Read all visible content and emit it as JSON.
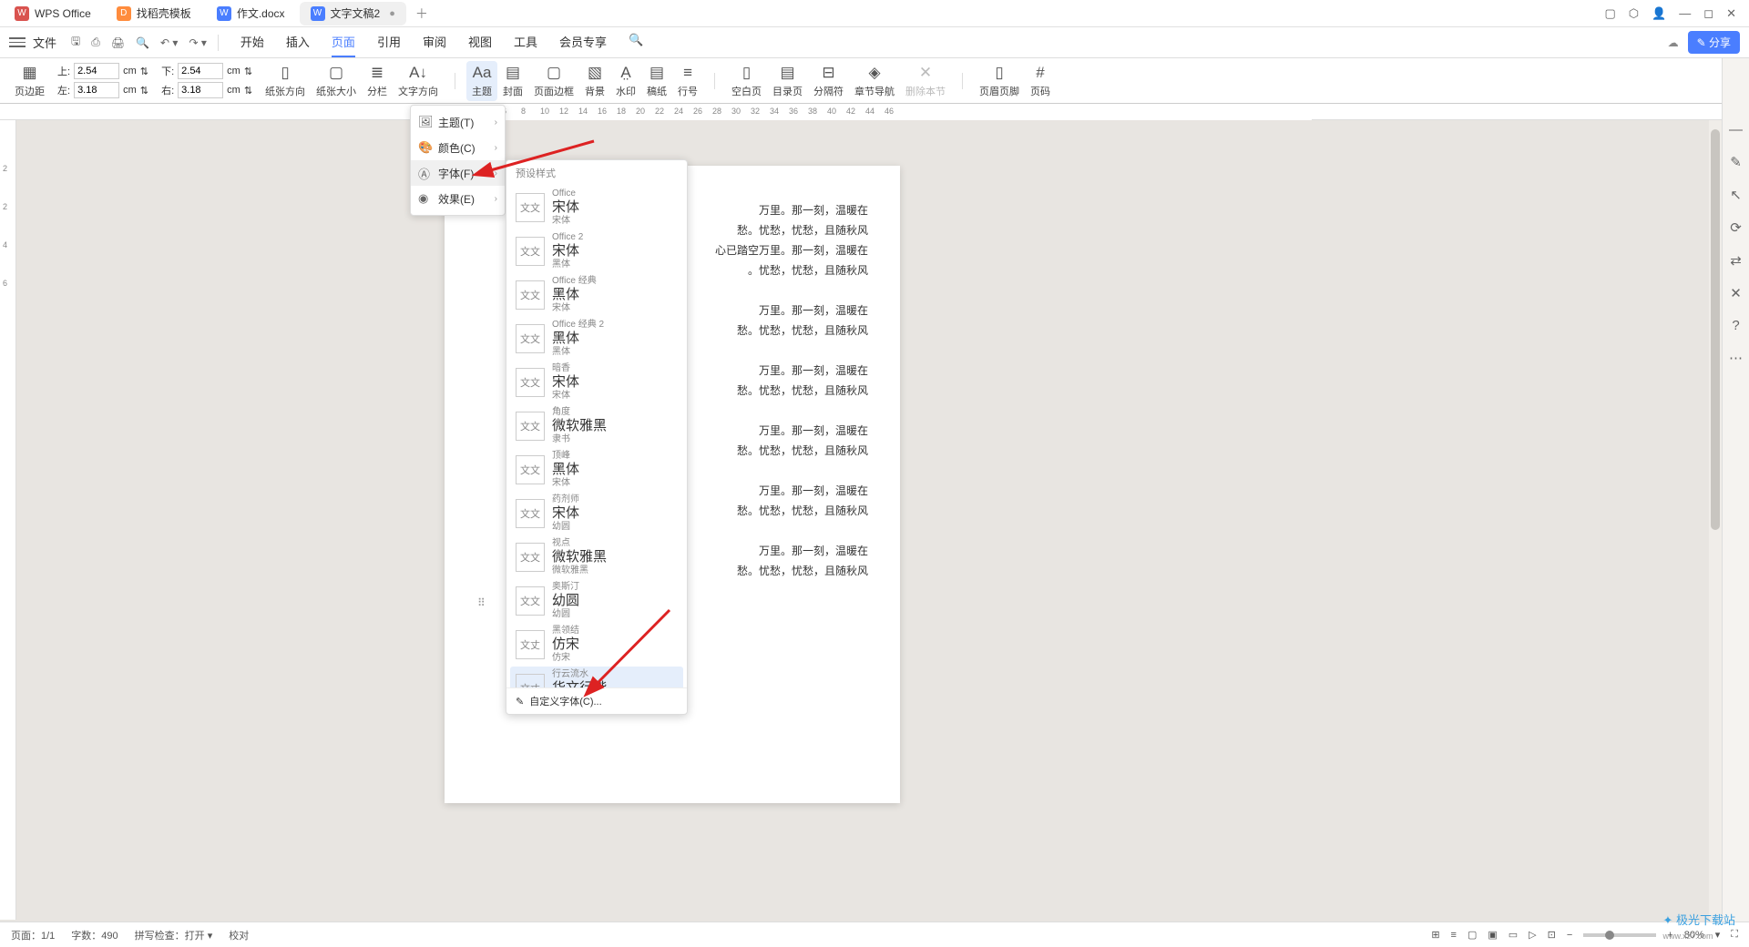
{
  "tabs": {
    "t0": {
      "label": "WPS Office"
    },
    "t1": {
      "label": "找稻壳模板"
    },
    "t2": {
      "label": "作文.docx"
    },
    "t3": {
      "label": "文字文稿2"
    }
  },
  "menu": {
    "file": "文件",
    "items": {
      "m0": "开始",
      "m1": "插入",
      "m2": "页面",
      "m3": "引用",
      "m4": "审阅",
      "m5": "视图",
      "m6": "工具",
      "m7": "会员专享"
    }
  },
  "share": "分享",
  "margins": {
    "top_lbl": "上:",
    "top": "2.54",
    "bottom_lbl": "下:",
    "bottom": "2.54",
    "left_lbl": "左:",
    "left": "3.18",
    "right_lbl": "右:",
    "right": "3.18",
    "unit": "cm"
  },
  "ribbon": {
    "r0": "页边距",
    "r1": "纸张方向",
    "r2": "纸张大小",
    "r3": "分栏",
    "r4": "文字方向",
    "r5": "主题",
    "r6": "封面",
    "r7": "页面边框",
    "r8": "背景",
    "r9": "水印",
    "r10": "稿纸",
    "r11": "行号",
    "r12": "空白页",
    "r13": "目录页",
    "r14": "分隔符",
    "r15": "章节导航",
    "r16": "删除本节",
    "r17": "页眉页脚",
    "r18": "页码"
  },
  "submenu": {
    "s0": "主题(T)",
    "s1": "颜色(C)",
    "s2": "字体(F)",
    "s3": "效果(E)"
  },
  "fontpanel": {
    "header": "预设样式",
    "preview": "文文",
    "previewAlt": "文丈",
    "items": [
      {
        "t": "Office",
        "m": "宋体",
        "b": "宋体"
      },
      {
        "t": "Office 2",
        "m": "宋体",
        "b": "黑体"
      },
      {
        "t": "Office 经典",
        "m": "黑体",
        "b": "宋体"
      },
      {
        "t": "Office 经典 2",
        "m": "黑体",
        "b": "黑体"
      },
      {
        "t": "暗香",
        "m": "宋体",
        "b": "宋体"
      },
      {
        "t": "角度",
        "m": "微软雅黑",
        "b": "隶书"
      },
      {
        "t": "顶峰",
        "m": "黑体",
        "b": "宋体"
      },
      {
        "t": "药剂师",
        "m": "宋体",
        "b": "幼圆"
      },
      {
        "t": "视点",
        "m": "微软雅黑",
        "b": "微软雅黑"
      },
      {
        "t": "奥斯汀",
        "m": "幼圆",
        "b": "幼圆"
      },
      {
        "t": "黑领结",
        "m": "仿宋",
        "b": "仿宋"
      },
      {
        "t": "行云流水",
        "m": "华文行楷",
        "b": "华文行楷"
      }
    ],
    "footer": "自定义字体(C)..."
  },
  "doc": {
    "l1": "万里。那一刻，温暖在",
    "l2": "愁。忧愁，忧愁，且随秋风",
    "l3": "心已踏空万里。那一刻，温暖在",
    "l4": "。忧愁，忧愁，且随秋风"
  },
  "status": {
    "page": "页面：1/1",
    "words": "字数：490",
    "spell": "拼写检查：打开",
    "proof": "校对",
    "zoom": "80%"
  },
  "watermark": {
    "name": "极光下载站",
    "url": "www.xz7.com"
  }
}
